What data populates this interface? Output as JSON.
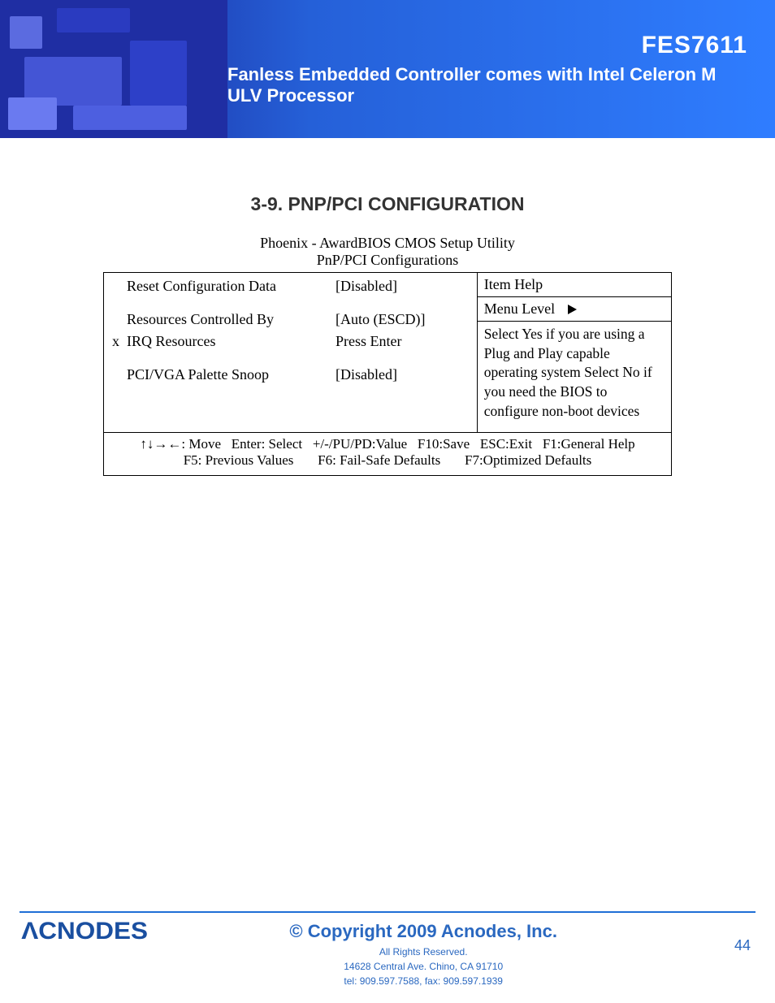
{
  "banner": {
    "product": "FES7611",
    "subtitle": "Fanless Embedded Controller comes with Intel Celeron M ULV Processor"
  },
  "section_title": "3-9. PNP/PCI CONFIGURATION",
  "bios": {
    "title": "Phoenix - AwardBIOS CMOS Setup Utility",
    "subtitle": "PnP/PCI Configurations",
    "items": {
      "reset_cfg": {
        "label": "Reset Configuration Data",
        "value": "[Disabled]"
      },
      "res_ctrl": {
        "label": "Resources Controlled By",
        "value": "[Auto (ESCD)]"
      },
      "irq": {
        "mark": "x",
        "label": "IRQ Resources",
        "value": "Press Enter"
      },
      "palette": {
        "label": "PCI/VGA Palette Snoop",
        "value": "[Disabled]"
      }
    },
    "help": {
      "header": "Item Help",
      "menu_level": "Menu Level",
      "text": "Select Yes if you are using a Plug and Play capable operating system Select No if you need the BIOS to configure non-boot devices"
    },
    "hints": {
      "line1": "↑↓→←: Move   Enter: Select   +/-/PU/PD:Value   F10:Save   ESC:Exit   F1:General Help",
      "line2": "F5: Previous Values       F6: Fail-Safe Defaults       F7:Optimized Defaults"
    }
  },
  "footer": {
    "logo_text": "ΛCNODES",
    "copyright": "© Copyright 2009 Acnodes, Inc.",
    "rights": "All Rights Reserved.",
    "addr": "14628 Central Ave. Chino, CA 91710",
    "tel": "tel: 909.597.7588, fax: 909.597.1939",
    "page": "44"
  }
}
